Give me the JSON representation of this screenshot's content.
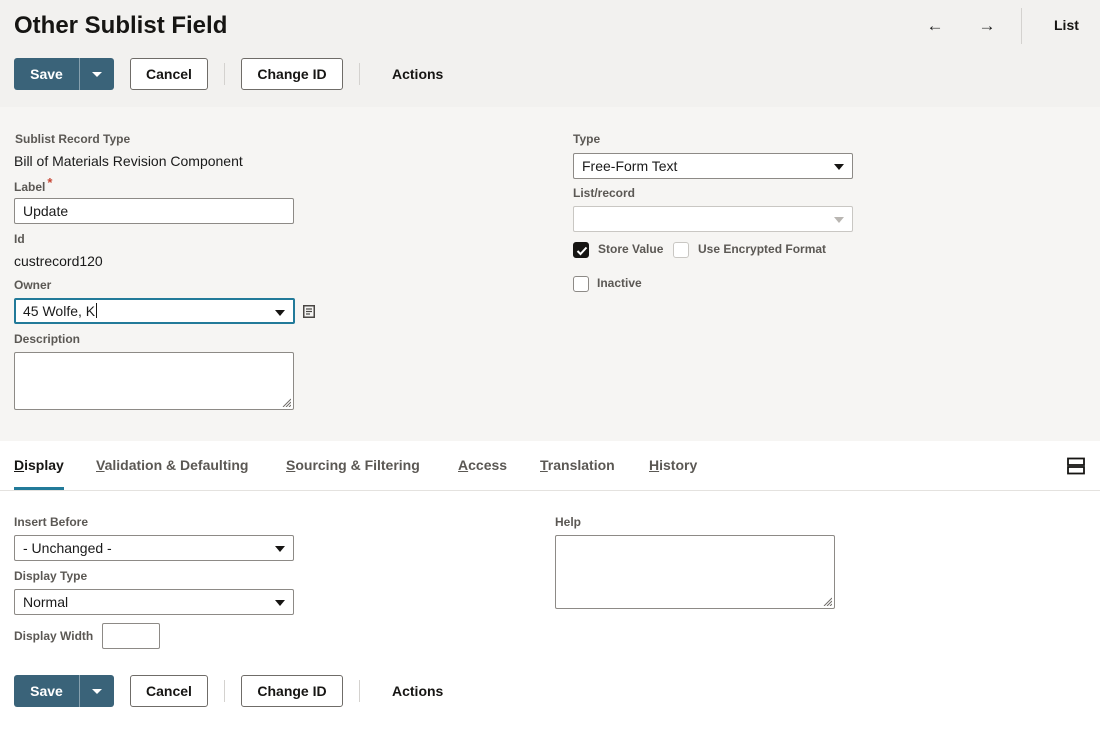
{
  "header": {
    "title": "Other Sublist Field",
    "back_arrow": "←",
    "forward_arrow": "→",
    "list_label": "List"
  },
  "toolbar": {
    "save_label": "Save",
    "cancel_label": "Cancel",
    "change_id_label": "Change ID",
    "actions_label": "Actions"
  },
  "form": {
    "sublist_record_type": {
      "label": "Sublist Record Type",
      "value": "Bill of Materials Revision Component"
    },
    "label_field": {
      "label": "Label",
      "required_marker": "*",
      "value": "Update"
    },
    "id_field": {
      "label": "Id",
      "value": "custrecord120"
    },
    "owner": {
      "label": "Owner",
      "value": "45 Wolfe, K"
    },
    "description": {
      "label": "Description",
      "value": ""
    },
    "type": {
      "label": "Type",
      "value": "Free-Form Text"
    },
    "list_record": {
      "label": "List/record",
      "value": ""
    },
    "store_value": {
      "label": "Store Value",
      "checked": true
    },
    "use_encrypted_format": {
      "label": "Use Encrypted Format",
      "checked": false
    },
    "inactive": {
      "label": "Inactive",
      "checked": false
    }
  },
  "tabs": [
    {
      "label": "Display",
      "key": "D",
      "rest": "isplay",
      "active": true
    },
    {
      "label": "Validation & Defaulting",
      "key": "V",
      "rest": "alidation & Defaulting",
      "active": false
    },
    {
      "label": "Sourcing & Filtering",
      "key": "S",
      "rest": "ourcing & Filtering",
      "active": false
    },
    {
      "label": "Access",
      "key": "A",
      "rest": "ccess",
      "active": false
    },
    {
      "label": "Translation",
      "key": "T",
      "rest": "ranslation",
      "active": false
    },
    {
      "label": "History",
      "key": "H",
      "rest": "istory",
      "active": false
    }
  ],
  "display_tab": {
    "insert_before": {
      "label": "Insert Before",
      "value": "- Unchanged -"
    },
    "display_type": {
      "label": "Display Type",
      "value": "Normal"
    },
    "display_width": {
      "label": "Display Width",
      "value": ""
    },
    "help": {
      "label": "Help",
      "value": ""
    }
  },
  "colors": {
    "primary_button": "#3a6379",
    "active_tab_underline": "#227a99",
    "required_star": "#c74634",
    "header_background": "#f2f1ef",
    "form_background": "#f6f5f3"
  },
  "icons": {
    "back": "arrow-left-icon",
    "forward": "arrow-right-icon",
    "save_menu": "caret-down-icon",
    "select_caret": "caret-down-icon",
    "owner_action": "document-list-icon",
    "resize": "resize-grip-icon",
    "checkmark": "checkmark-icon",
    "layout_toggle": "stacked-layout-icon"
  }
}
